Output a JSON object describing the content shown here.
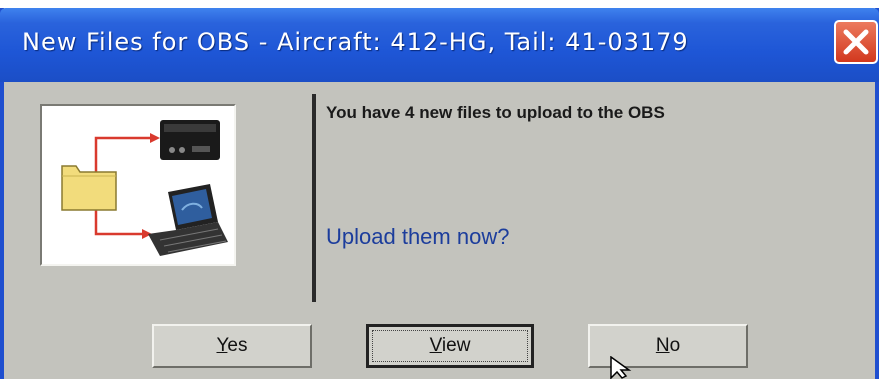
{
  "window": {
    "title": "New Files for OBS - Aircraft: 412-HG, Tail: 41-03179"
  },
  "message": {
    "line1": "You have 4 new files to upload to the OBS",
    "question": "Upload them now?"
  },
  "buttons": {
    "yes": {
      "mnemonic": "Y",
      "rest": "es"
    },
    "view": {
      "mnemonic": "V",
      "rest": "iew"
    },
    "no": {
      "mnemonic": "N",
      "rest": "o"
    }
  },
  "icons": {
    "close": "close-icon",
    "folder": "folder-icon",
    "device": "obs-device-icon",
    "laptop": "laptop-icon"
  },
  "colors": {
    "titlebar": "#1e56d6",
    "close": "#d2381e",
    "question": "#1c3d9c",
    "arrow": "#d93a2e"
  }
}
